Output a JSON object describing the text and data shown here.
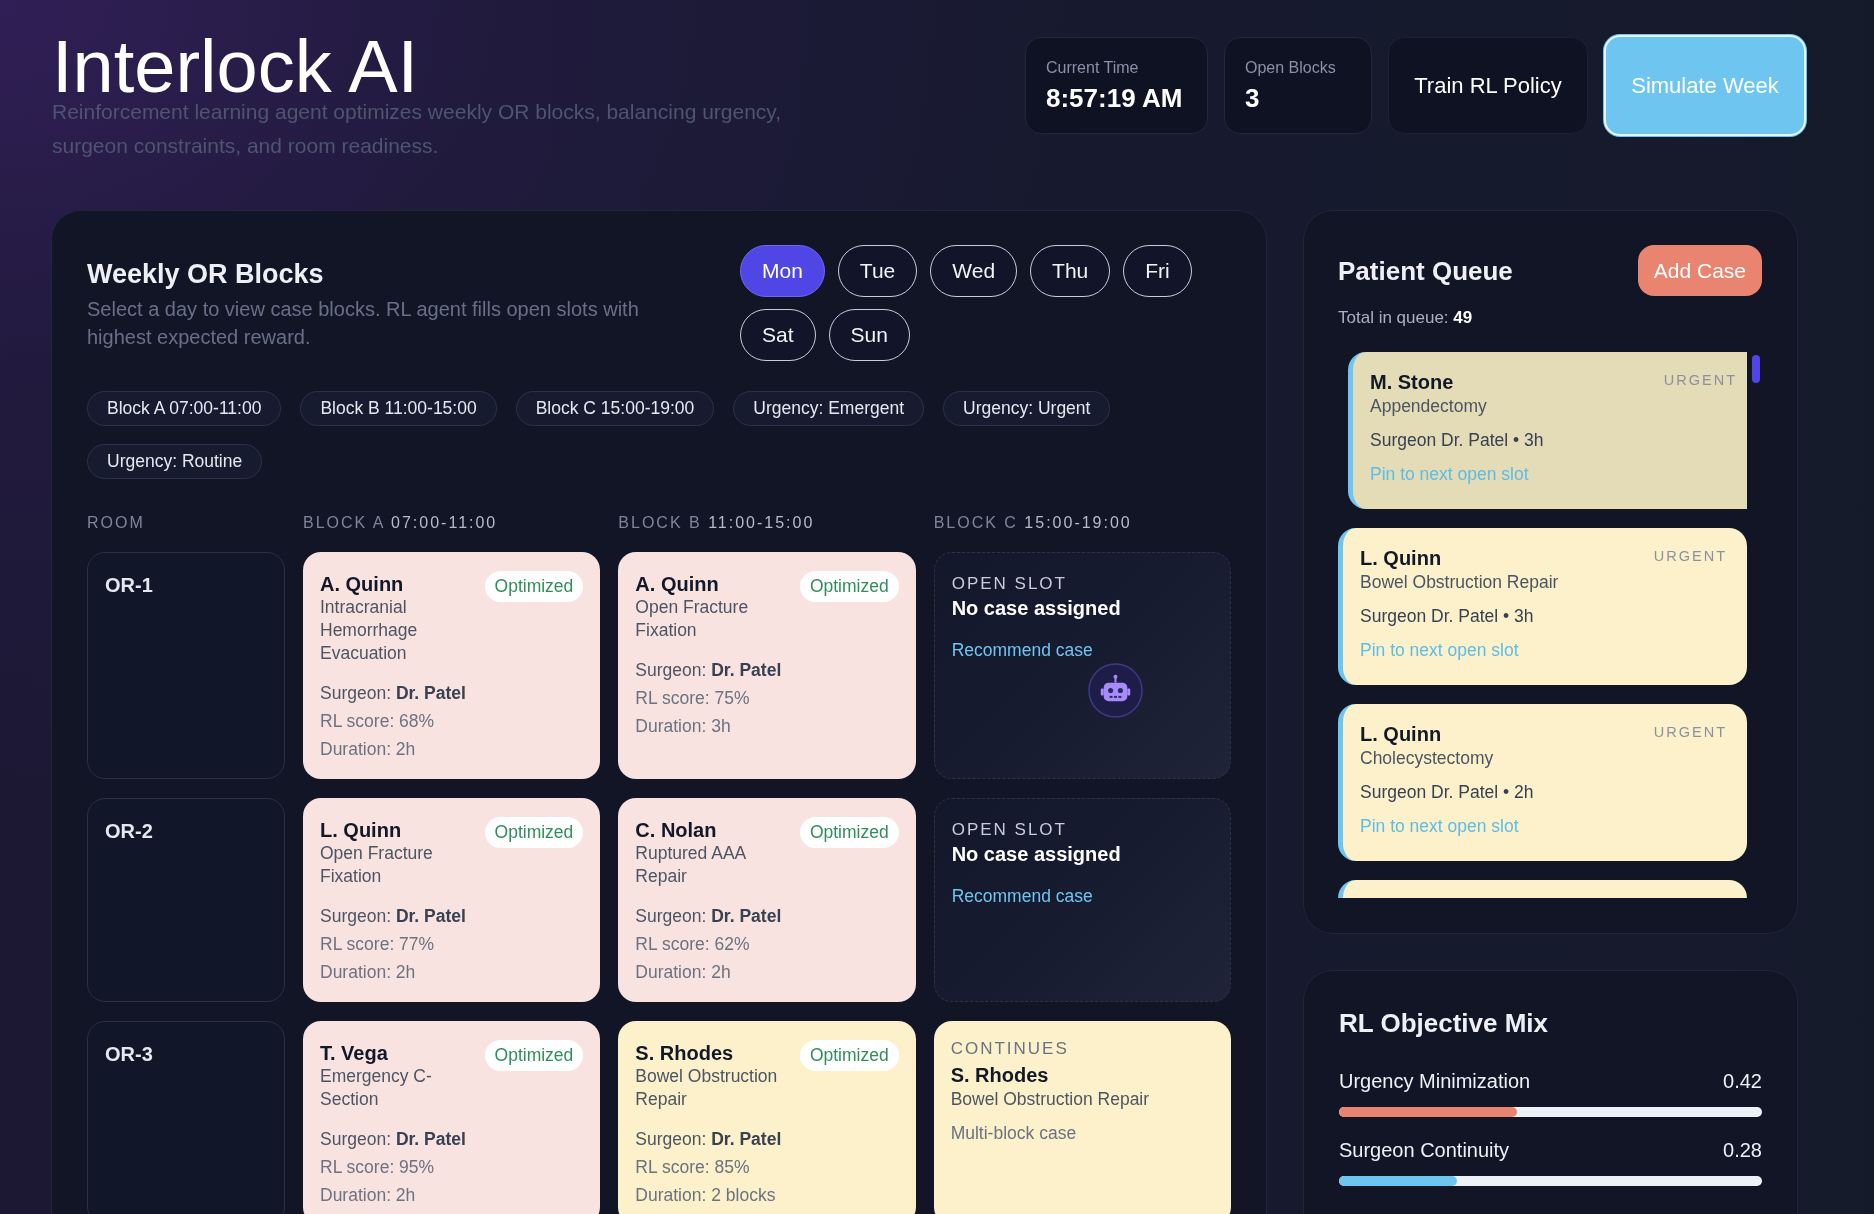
{
  "app": {
    "title": "Interlock AI",
    "subtitle": "Reinforcement learning agent optimizes weekly OR blocks, balancing urgency, surgeon constraints, and room readiness."
  },
  "header": {
    "stats": [
      {
        "label": "Current Time",
        "value": "8:57:19 AM"
      },
      {
        "label": "Open Blocks",
        "value": "3"
      }
    ],
    "actions": [
      {
        "label": "Train RL Policy",
        "kind": "secondary"
      },
      {
        "label": "Simulate Week",
        "kind": "primary"
      }
    ]
  },
  "weekly_blocks": {
    "title": "Weekly OR Blocks",
    "description": "Select a day to view case blocks. RL agent fills open slots with highest expected reward.",
    "days": [
      {
        "label": "Mon",
        "selected": true
      },
      {
        "label": "Tue",
        "selected": false
      },
      {
        "label": "Wed",
        "selected": false
      },
      {
        "label": "Thu",
        "selected": false
      },
      {
        "label": "Fri",
        "selected": false
      },
      {
        "label": "Sat",
        "selected": false
      },
      {
        "label": "Sun",
        "selected": false
      }
    ],
    "legend": [
      "Block A 07:00-11:00",
      "Block B 11:00-15:00",
      "Block C 15:00-19:00",
      "Urgency: Emergent",
      "Urgency: Urgent",
      "Urgency: Routine"
    ],
    "columns": [
      {
        "label": "ROOM"
      },
      {
        "label": "BLOCK A",
        "time": "07:00-11:00"
      },
      {
        "label": "BLOCK B",
        "time": "11:00-15:00"
      },
      {
        "label": "BLOCK C",
        "time": "15:00-19:00"
      }
    ],
    "rooms": [
      {
        "name": "OR-1",
        "slots": [
          {
            "kind": "case",
            "color": "#f9e3e1",
            "patient": "A. Quinn",
            "procedure": "Intracranial Hemorrhage Evacuation",
            "badge": "Optimized",
            "surgeon": "Surgeon: **Dr. Patel**",
            "score": "RL score: 68%",
            "duration": "Duration: 2h"
          },
          {
            "kind": "case",
            "color": "#f9e3e1",
            "patient": "A. Quinn",
            "procedure": "Open Fracture Fixation",
            "badge": "Optimized",
            "surgeon": "Surgeon: **Dr. Patel**",
            "score": "RL score: 75%",
            "duration": "Duration: 3h"
          },
          {
            "kind": "open",
            "label": "OPEN SLOT",
            "title": "No case assigned",
            "action": "Recommend case",
            "agent_hint": true
          }
        ]
      },
      {
        "name": "OR-2",
        "slots": [
          {
            "kind": "case",
            "color": "#f9e3e1",
            "patient": "L. Quinn",
            "procedure": "Open Fracture Fixation",
            "badge": "Optimized",
            "surgeon": "Surgeon: **Dr. Patel**",
            "score": "RL score: 77%",
            "duration": "Duration: 2h"
          },
          {
            "kind": "case",
            "color": "#f9e3e1",
            "patient": "C. Nolan",
            "procedure": "Ruptured AAA Repair",
            "badge": "Optimized",
            "surgeon": "Surgeon: **Dr. Patel**",
            "score": "RL score: 62%",
            "duration": "Duration: 2h"
          },
          {
            "kind": "open",
            "label": "OPEN SLOT",
            "title": "No case assigned",
            "action": "Recommend case",
            "agent_hint": false
          }
        ]
      },
      {
        "name": "OR-3",
        "slots": [
          {
            "kind": "case",
            "color": "#f9e3e1",
            "patient": "T. Vega",
            "procedure": "Emergency C-Section",
            "badge": "Optimized",
            "surgeon": "Surgeon: **Dr. Patel**",
            "score": "RL score: 95%",
            "duration": "Duration: 2h"
          },
          {
            "kind": "case",
            "color": "#fcf1cb",
            "patient": "S. Rhodes",
            "procedure": "Bowel Obstruction Repair",
            "badge": "Optimized",
            "surgeon": "Surgeon: **Dr. Patel**",
            "score": "RL score: 85%",
            "duration": "Duration: 2 blocks"
          },
          {
            "kind": "continues",
            "color": "#fcf1cb",
            "label": "CONTINUES",
            "patient": "S. Rhodes",
            "procedure": "Bowel Obstruction Repair",
            "note": "Multi-block case"
          }
        ]
      }
    ]
  },
  "patient_queue": {
    "title": "Patient Queue",
    "add_button": "Add Case",
    "total": "Total in queue: **49**",
    "items": [
      {
        "patient": "M. Stone",
        "urgency": "URGENT",
        "procedure": "Appendectomy",
        "details": "Surgeon Dr. Patel • 3h",
        "action": "Pin to next open slot",
        "selected": true
      },
      {
        "patient": "L. Quinn",
        "urgency": "URGENT",
        "procedure": "Bowel Obstruction Repair",
        "details": "Surgeon Dr. Patel • 3h",
        "action": "Pin to next open slot",
        "selected": false
      },
      {
        "patient": "L. Quinn",
        "urgency": "URGENT",
        "procedure": "Cholecystectomy",
        "details": "Surgeon Dr. Patel • 2h",
        "action": "Pin to next open slot",
        "selected": false
      }
    ]
  },
  "objective_mix": {
    "title": "RL Objective Mix",
    "items": [
      {
        "label": "Urgency Minimization",
        "value": "0.42",
        "level": 0.42,
        "color": "#e8846f"
      },
      {
        "label": "Surgeon Continuity",
        "value": "0.28",
        "level": 0.28,
        "color": "#6ec6f0"
      }
    ]
  }
}
